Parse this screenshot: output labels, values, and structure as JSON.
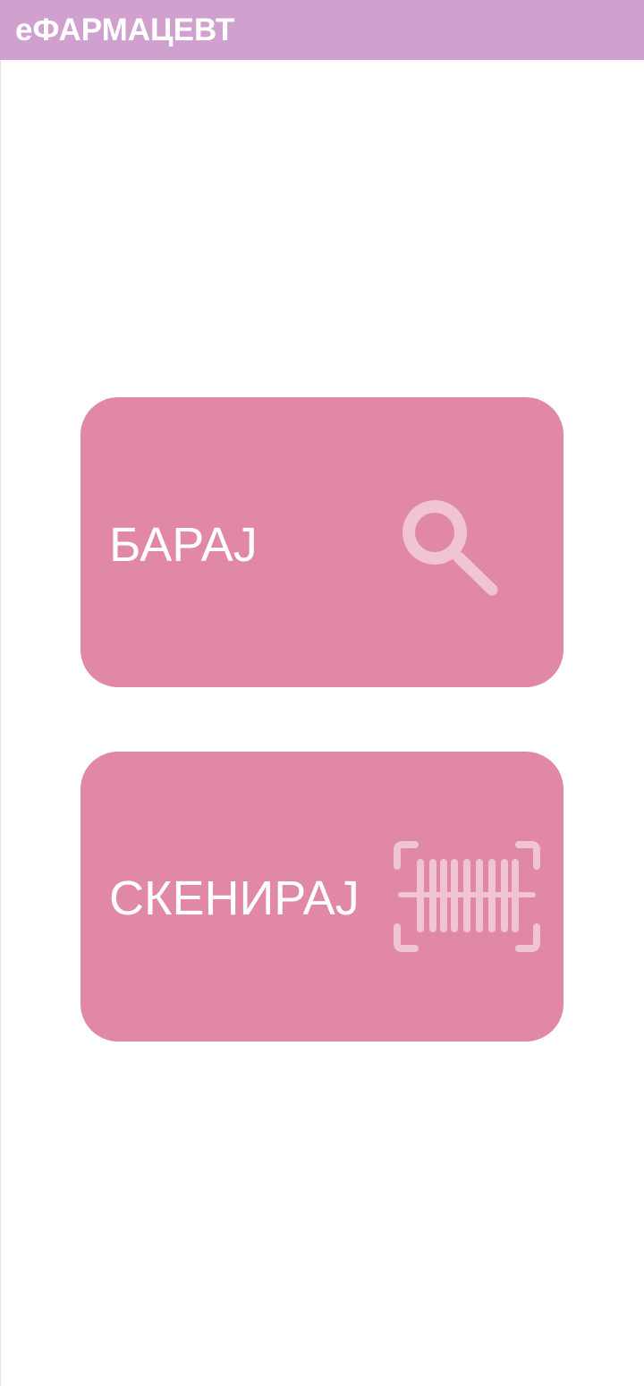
{
  "app_bar": {
    "title": "еФАРМАЦЕВТ",
    "background": "#d0a0cf"
  },
  "actions": {
    "search": {
      "label": "БАРАЈ",
      "icon": "magnifier-icon"
    },
    "scan": {
      "label": "СКЕНИРАЈ",
      "icon": "barcode-scan-icon"
    }
  },
  "colors": {
    "card": "#e088a6",
    "icon_tint": "#f0c3d5",
    "label": "#ffffff"
  }
}
